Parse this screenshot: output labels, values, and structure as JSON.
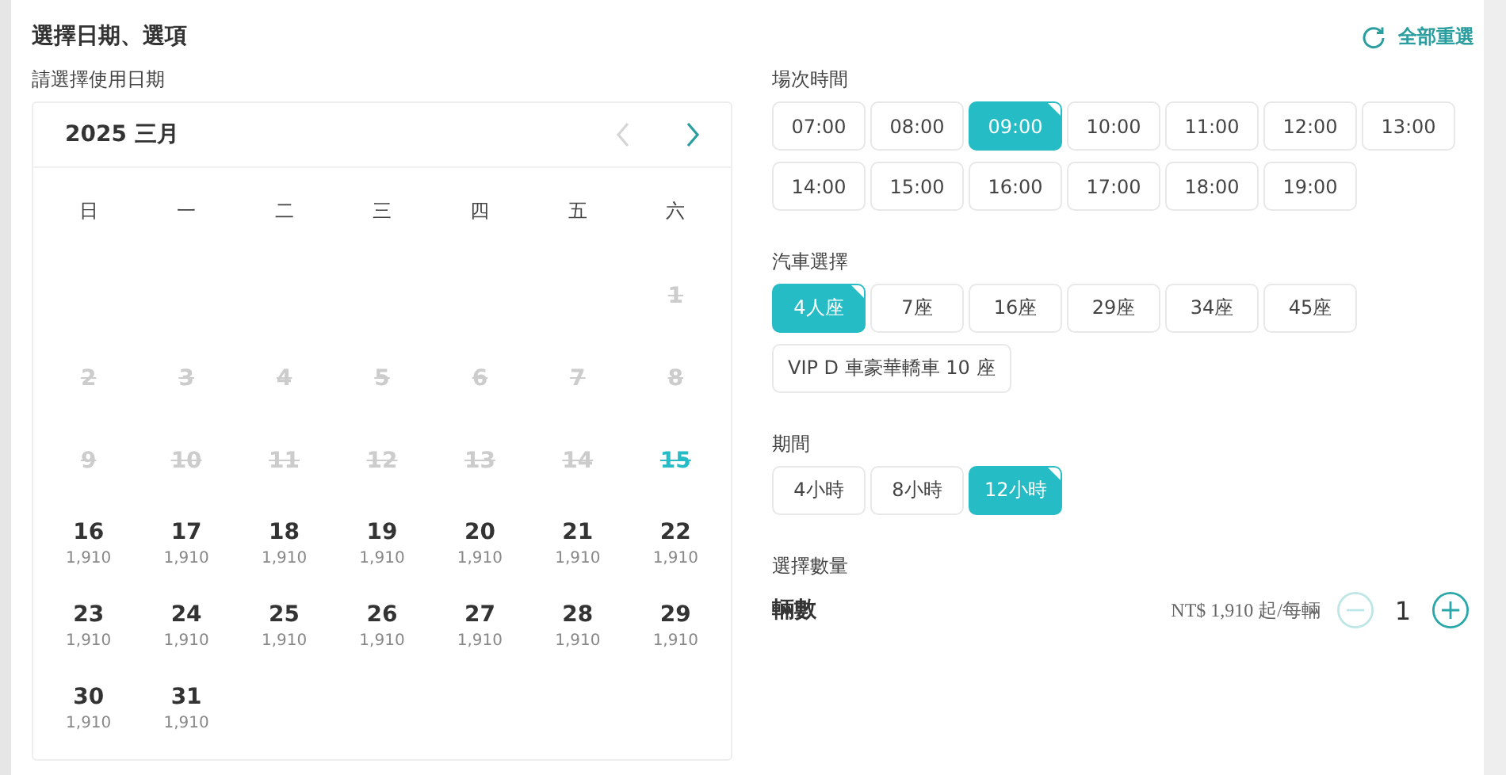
{
  "title": "選擇日期、選項",
  "reset": {
    "label": "全部重選"
  },
  "date_label": "請選擇使用日期",
  "calendar": {
    "year": "2025",
    "month": "三月",
    "prev": {
      "disabled": true
    },
    "next": {
      "disabled": false
    },
    "weekdays": [
      "日",
      "一",
      "二",
      "三",
      "四",
      "五",
      "六"
    ],
    "weeks": [
      [
        {
          "day": "1",
          "disabled": true,
          "today": false
        }
      ],
      [
        {
          "day": "2",
          "disabled": true,
          "today": false
        },
        {
          "day": "3",
          "disabled": true,
          "today": false
        },
        {
          "day": "4",
          "disabled": true,
          "today": false
        },
        {
          "day": "5",
          "disabled": true,
          "today": false
        },
        {
          "day": "6",
          "disabled": true,
          "today": false
        },
        {
          "day": "7",
          "disabled": true,
          "today": false
        },
        {
          "day": "8",
          "disabled": true,
          "today": false
        }
      ],
      [
        {
          "day": "9",
          "disabled": true,
          "today": false
        },
        {
          "day": "10",
          "disabled": true,
          "today": false
        },
        {
          "day": "11",
          "disabled": true,
          "today": false
        },
        {
          "day": "12",
          "disabled": true,
          "today": false
        },
        {
          "day": "13",
          "disabled": true,
          "today": false
        },
        {
          "day": "14",
          "disabled": true,
          "today": false
        },
        {
          "day": "15",
          "disabled": true,
          "today": true
        }
      ],
      [
        {
          "day": "16",
          "price": "1,910",
          "disabled": false,
          "today": false
        },
        {
          "day": "17",
          "price": "1,910",
          "disabled": false,
          "today": false
        },
        {
          "day": "18",
          "price": "1,910",
          "disabled": false,
          "today": false
        },
        {
          "day": "19",
          "price": "1,910",
          "disabled": false,
          "today": false
        },
        {
          "day": "20",
          "price": "1,910",
          "disabled": false,
          "today": false
        },
        {
          "day": "21",
          "price": "1,910",
          "disabled": false,
          "today": false
        },
        {
          "day": "22",
          "price": "1,910",
          "disabled": false,
          "today": false
        }
      ],
      [
        {
          "day": "23",
          "price": "1,910",
          "disabled": false,
          "today": false
        },
        {
          "day": "24",
          "price": "1,910",
          "disabled": false,
          "today": false
        },
        {
          "day": "25",
          "price": "1,910",
          "disabled": false,
          "today": false
        },
        {
          "day": "26",
          "price": "1,910",
          "disabled": false,
          "today": false
        },
        {
          "day": "27",
          "price": "1,910",
          "disabled": false,
          "today": false
        },
        {
          "day": "28",
          "price": "1,910",
          "disabled": false,
          "today": false
        },
        {
          "day": "29",
          "price": "1,910",
          "disabled": false,
          "today": false
        }
      ],
      [
        {
          "day": "30",
          "price": "1,910",
          "disabled": false,
          "today": false
        },
        {
          "day": "31",
          "price": "1,910",
          "disabled": false,
          "today": false
        }
      ]
    ]
  },
  "groups": [
    {
      "label": "場次時間",
      "options": [
        {
          "label": "07:00",
          "selected": false
        },
        {
          "label": "08:00",
          "selected": false
        },
        {
          "label": "09:00",
          "selected": true
        },
        {
          "label": "10:00",
          "selected": false
        },
        {
          "label": "11:00",
          "selected": false
        },
        {
          "label": "12:00",
          "selected": false
        },
        {
          "label": "13:00",
          "selected": false
        },
        {
          "label": "14:00",
          "selected": false
        },
        {
          "label": "15:00",
          "selected": false
        },
        {
          "label": "16:00",
          "selected": false
        },
        {
          "label": "17:00",
          "selected": false
        },
        {
          "label": "18:00",
          "selected": false
        },
        {
          "label": "19:00",
          "selected": false
        }
      ]
    },
    {
      "label": "汽車選擇",
      "options": [
        {
          "label": "4人座",
          "selected": true
        },
        {
          "label": "7座",
          "selected": false
        },
        {
          "label": "16座",
          "selected": false
        },
        {
          "label": "29座",
          "selected": false
        },
        {
          "label": "34座",
          "selected": false
        },
        {
          "label": "45座",
          "selected": false
        },
        {
          "label": "VIP D 車豪華轎車 10 座",
          "selected": false
        }
      ]
    },
    {
      "label": "期間",
      "options": [
        {
          "label": "4小時",
          "selected": false
        },
        {
          "label": "8小時",
          "selected": false
        },
        {
          "label": "12小時",
          "selected": true
        }
      ]
    }
  ],
  "quantity": {
    "label": "選擇數量",
    "item": "輛數",
    "price": "NT$ 1,910 起/每輛",
    "value": "1",
    "minus_disabled": true,
    "plus_disabled": false
  }
}
